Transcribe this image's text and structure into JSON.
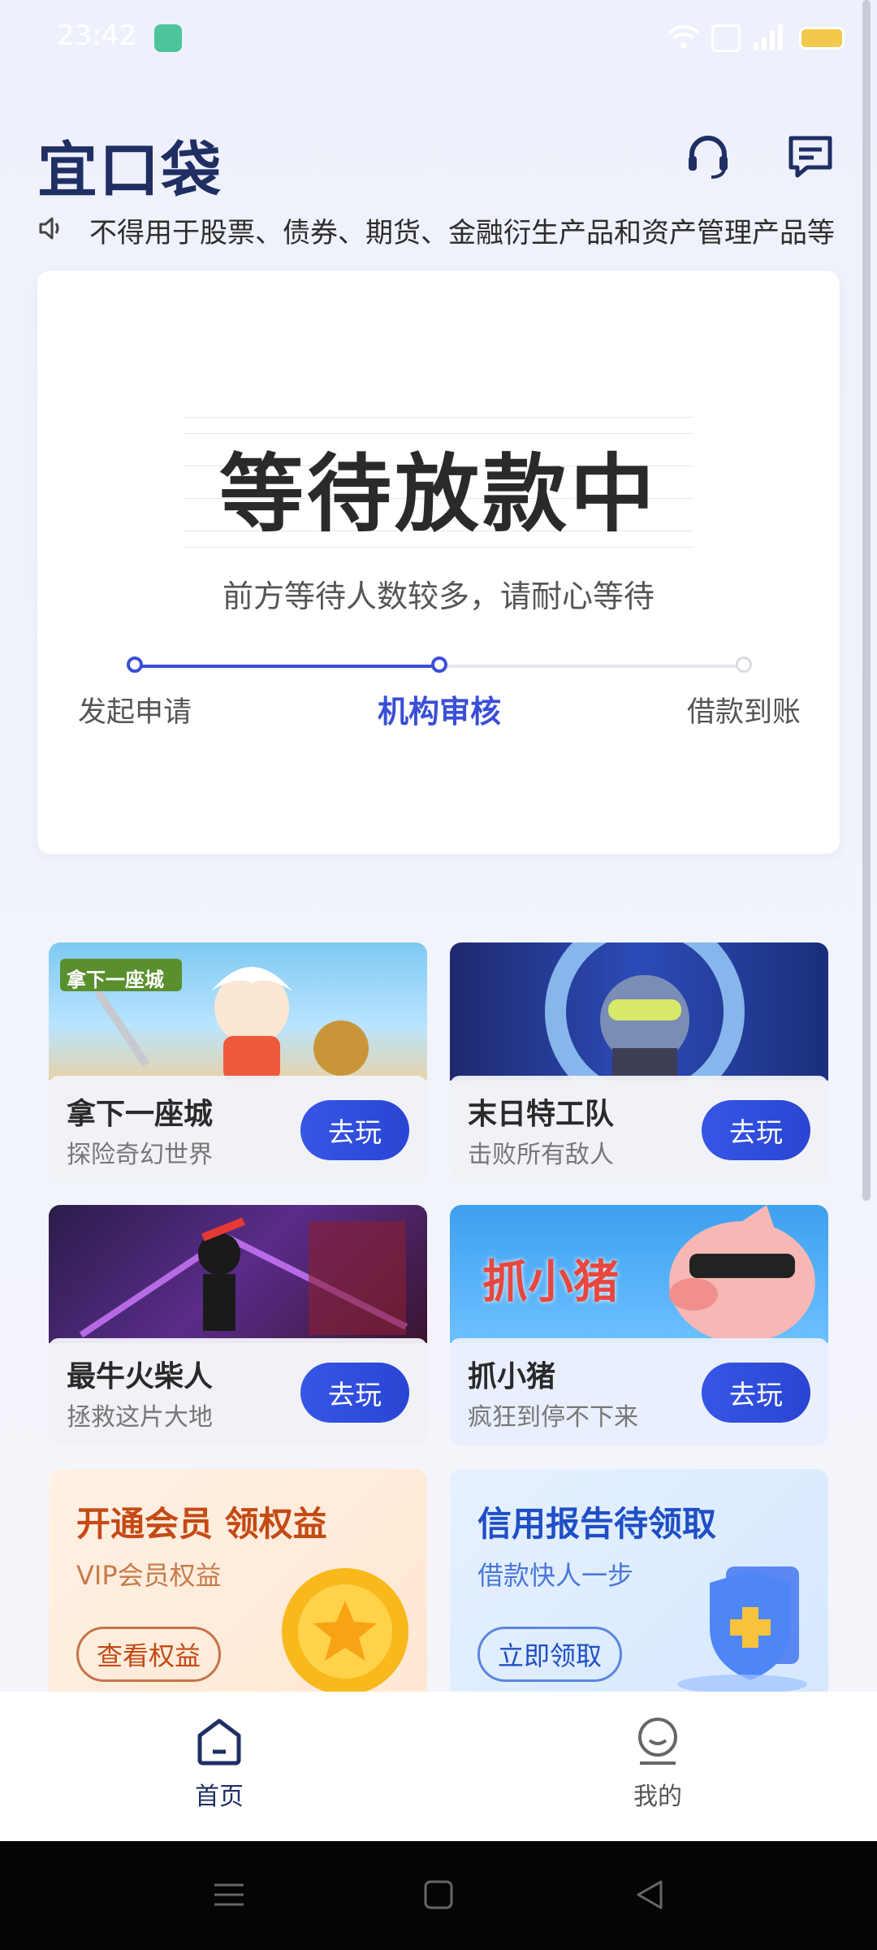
{
  "status_bar": {
    "time": "23:42"
  },
  "header": {
    "logo": "宜口袋",
    "notice": "不得用于股票、债券、期货、金融衍生产品和资产管理产品等"
  },
  "status_card": {
    "title": "等待放款中",
    "subtitle": "前方等待人数较多，请耐心等待",
    "steps": [
      {
        "label": "发起申请",
        "state": "done"
      },
      {
        "label": "机构审核",
        "state": "current"
      },
      {
        "label": "借款到账",
        "state": "pending"
      }
    ],
    "progress": 0.5
  },
  "games": [
    {
      "title": "拿下一座城",
      "subtitle": "探险奇幻世界",
      "button": "去玩",
      "badge": "拿下一座城"
    },
    {
      "title": "末日特工队",
      "subtitle": "击败所有敌人",
      "button": "去玩"
    },
    {
      "title": "最牛火柴人",
      "subtitle": "拯救这片大地",
      "button": "去玩"
    },
    {
      "title": "抓小猪",
      "subtitle": "疯狂到停不下来",
      "button": "去玩",
      "badge": "抓小猪"
    }
  ],
  "promos": [
    {
      "title": "开通会员 领权益",
      "subtitle": "VIP会员权益",
      "button": "查看权益"
    },
    {
      "title": "信用报告待领取",
      "subtitle": "借款快人一步",
      "button": "立即领取"
    }
  ],
  "bottom_nav": [
    {
      "label": "首页",
      "icon": "home-icon",
      "active": true
    },
    {
      "label": "我的",
      "icon": "profile-icon",
      "active": false
    }
  ],
  "colors": {
    "accent": "#3a4fd6",
    "brand": "#1f2f63"
  }
}
